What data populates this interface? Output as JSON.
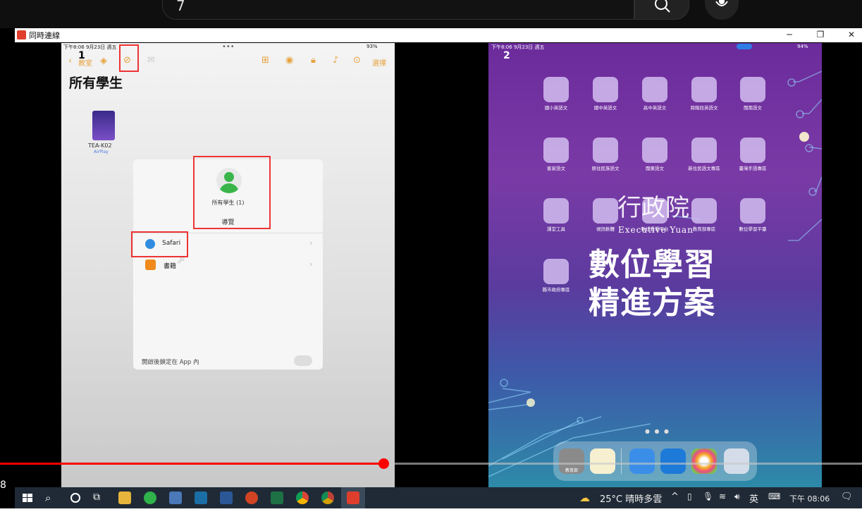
{
  "search": {
    "value": "7"
  },
  "window": {
    "title": "同時連線"
  },
  "left_ipad": {
    "label": "1",
    "status_time": "下午8:06  9月23日 週五",
    "status_dots": "•••",
    "status_right": "93%",
    "back_label": "教室",
    "toolbar_select": "選擇",
    "heading": "所有學生",
    "device_name": "TEA-K02",
    "device_sub": "AirPlay",
    "sheet": {
      "title": "所有學生 (1)",
      "guide_label": "導覽",
      "items": [
        {
          "label": "Safari",
          "icon": "safari-icon"
        },
        {
          "label": "書籍",
          "icon": "books-icon"
        }
      ],
      "lock_label": "開啟後鎖定在 App 內"
    }
  },
  "right_ipad": {
    "label": "2",
    "status_time": "下午8:06  9月23日 週五",
    "status_right": "94%",
    "folders": [
      "國小英語文",
      "國中英語文",
      "高中英語文",
      "跨階段英語文",
      "閩南語文",
      "客家語文",
      "原住民族語文",
      "閩東語文",
      "新住民語文專區",
      "臺灣手語專區",
      "課堂工具",
      "視訊軟體",
      "數位教學平台",
      "教育部專區",
      "數位學習平臺",
      "縣市政府專區"
    ],
    "watermark_org": "行政院",
    "watermark_en": "Executive Yuan",
    "hero_line1": "數位學習",
    "hero_line2": "精進方案",
    "dock_first": "教育部"
  },
  "video": {
    "progress_fraction": 0.445,
    "time_partial": "8"
  },
  "taskbar": {
    "weather": "25°C 晴時多雲",
    "ime": "英",
    "clock": "下午 08:06"
  }
}
